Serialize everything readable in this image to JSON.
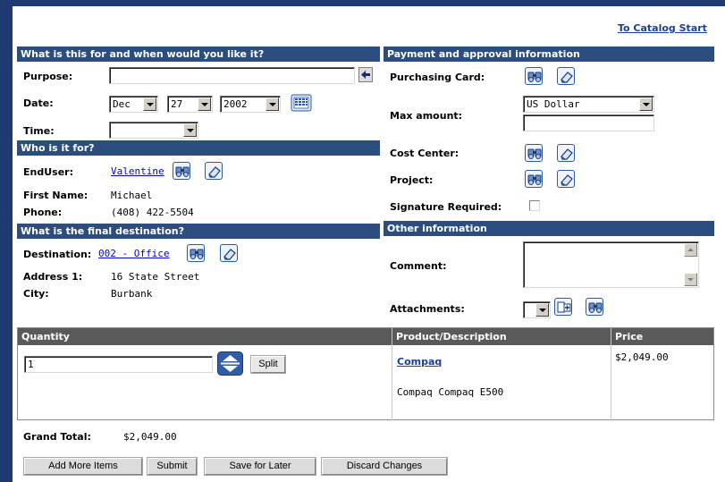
{
  "header": {
    "catalog_link": "To Catalog Start"
  },
  "purpose_section": {
    "title": "What is this for and when would you like it?",
    "purpose_label": "Purpose:",
    "purpose_value": "",
    "date_label": "Date:",
    "date_month": "Dec",
    "date_day": "27",
    "date_year": "2002",
    "time_label": "Time:",
    "time_value": ""
  },
  "who_section": {
    "title": "Who is it for?",
    "enduser_label": "EndUser:",
    "enduser_value": "Valentine",
    "firstname_label": "First Name:",
    "firstname_value": "Michael",
    "phone_label": "Phone:",
    "phone_value": "(408) 422-5504"
  },
  "destination_section": {
    "title": "What is the final destination?",
    "destination_label": "Destination:",
    "destination_value": "002 - Office",
    "address_label": "Address 1:",
    "address_value": "16 State Street",
    "city_label": "City:",
    "city_value": "Burbank"
  },
  "payment_section": {
    "title": "Payment and approval information",
    "card_label": "Purchasing Card:",
    "max_amount_label": "Max amount:",
    "currency_value": "US Dollar",
    "amount_value": "",
    "cost_center_label": "Cost Center:",
    "project_label": "Project:",
    "signature_label": "Signature Required:",
    "signature_checked": false
  },
  "other_section": {
    "title": "Other information",
    "comment_label": "Comment:",
    "comment_value": "",
    "attachments_label": "Attachments:"
  },
  "items": {
    "headers": {
      "quantity": "Quantity",
      "product": "Product/Description",
      "price": "Price"
    },
    "row": {
      "quantity": "1",
      "split_label": "Split",
      "product_name": "Compaq",
      "description": "Compaq Compaq E500",
      "price": "$2,049.00"
    }
  },
  "totals": {
    "grand_total_label": "Grand Total:",
    "grand_total_value": "$2,049.00"
  },
  "actions": {
    "add_more": "Add More Items",
    "submit": "Submit",
    "save_later": "Save for Later",
    "discard": "Discard Changes"
  },
  "icons": {
    "calendar": "calendar-icon",
    "search": "search-icon",
    "clear": "eraser-icon",
    "insert": "arrow-left-icon",
    "attach": "add-attachment-icon",
    "spinner": "up-down-arrows-icon"
  },
  "colors": {
    "section_header": "#2b4e7e",
    "frame": "#1f3a73",
    "column_header": "#5a5a5a",
    "link": "#0000ee"
  }
}
